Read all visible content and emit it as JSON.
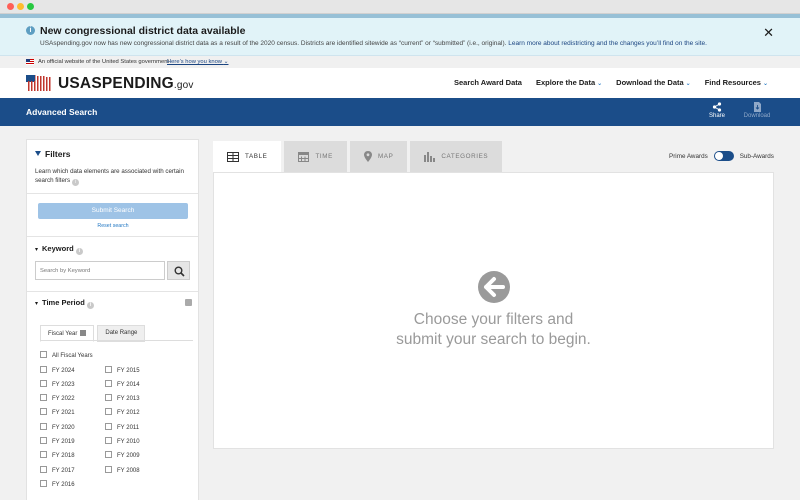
{
  "alert": {
    "title": "New congressional district data available",
    "text": "USAspending.gov now has new congressional district data as a result of the 2020 census. Districts are identified sitewide as “current” or “submitted” (i.e., original).",
    "link": "Learn more about redistricting and the changes you’ll find on the site."
  },
  "gov_banner": {
    "text": "An official website of the United States government",
    "link": "Here’s how you know"
  },
  "header": {
    "logo_main": "USASPENDING",
    "logo_suffix": ".gov",
    "nav": [
      {
        "label": "Search Award Data"
      },
      {
        "label": "Explore the Data"
      },
      {
        "label": "Download the Data"
      },
      {
        "label": "Find Resources"
      }
    ]
  },
  "titlebar": {
    "title": "Advanced Search",
    "share": "Share",
    "download": "Download"
  },
  "sidebar": {
    "title": "Filters",
    "learn": "Learn which data elements are associated with certain search filters",
    "submit": "Submit Search",
    "reset": "Reset search",
    "keyword": {
      "title": "Keyword",
      "placeholder": "Search by Keyword"
    },
    "time_period": {
      "title": "Time Period",
      "tabs": [
        "Fiscal Year",
        "Date Range"
      ],
      "all_label": "All Fiscal Years",
      "col1": [
        "FY 2024",
        "FY 2023",
        "FY 2022",
        "FY 2021",
        "FY 2020",
        "FY 2019",
        "FY 2018",
        "FY 2017",
        "FY 2016"
      ],
      "col2": [
        "FY 2015",
        "FY 2014",
        "FY 2013",
        "FY 2012",
        "FY 2011",
        "FY 2010",
        "FY 2009",
        "FY 2008"
      ]
    }
  },
  "main": {
    "tabs": [
      "TABLE",
      "TIME",
      "MAP",
      "CATEGORIES"
    ],
    "prime_label": "Prime Awards",
    "sub_label": "Sub-Awards",
    "empty_line1": "Choose your filters and",
    "empty_line2": "submit your search to begin."
  },
  "colors": {
    "brand_blue": "#1b4d89",
    "link_blue": "#2378c3",
    "alert_bg": "#e1f3f8"
  }
}
